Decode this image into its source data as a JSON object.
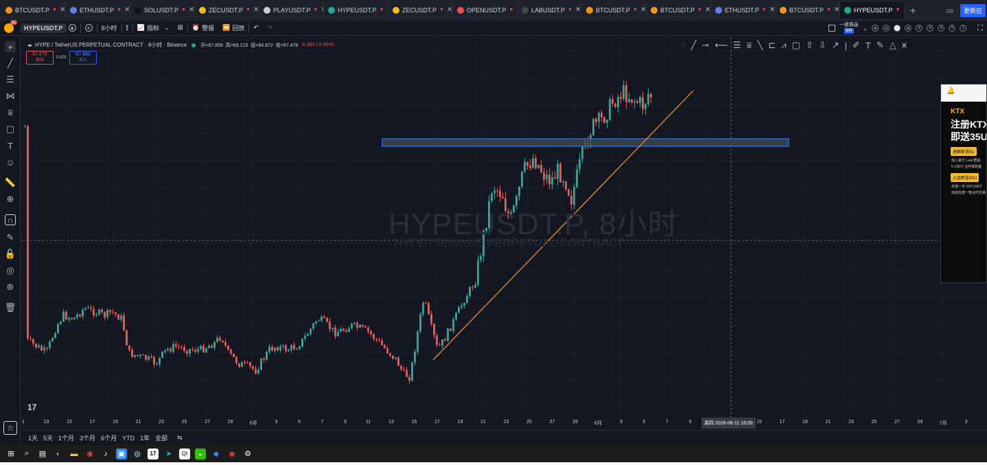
{
  "tabs": [
    {
      "label": "BTCUSDT.P",
      "color": "#f7931a"
    },
    {
      "label": "ETHUSDT.P",
      "color": "#627eea"
    },
    {
      "label": "SOLUSDT.P",
      "color": "#111111"
    },
    {
      "label": "ZECUSDT.P",
      "color": "#f4b728"
    },
    {
      "label": "PLAYUSDT.P",
      "color": "#cccccc"
    },
    {
      "label": "HYPEUSDT.P",
      "color": "#26a69a"
    },
    {
      "label": "ZECUSDT.P",
      "color": "#f4b728"
    },
    {
      "label": "OPENUSDT.P",
      "color": "#ef5350"
    },
    {
      "label": "LABUSDT.P",
      "color": "#444444"
    },
    {
      "label": "BTCUSDT.P",
      "color": "#f7931a"
    },
    {
      "label": "BTCUSDT.P",
      "color": "#f7931a"
    },
    {
      "label": "ETHUSDT.P",
      "color": "#627eea"
    },
    {
      "label": "BTCUSDT.P",
      "color": "#f7931a"
    },
    {
      "label": "HYPEUSDT.P",
      "color": "#26a69a",
      "active": true
    }
  ],
  "update_button": "更新应",
  "toolbar": {
    "symbol": "HYPEUSDT.P",
    "badge": "11",
    "interval": "8小时",
    "indicators": "指标",
    "alert": "警报",
    "replay": "回放",
    "layout": "一键换画",
    "layout_sub": "保存"
  },
  "legend": {
    "symbol": "HYPE / TetherUS PERPETUAL CONTRACT · 8小时 · Binance",
    "open": "开=67.859",
    "high": "高=69.123",
    "low": "低=64.872",
    "close": "收=67.476",
    "change": "-0.383 (-0.56%)"
  },
  "order": {
    "sell_price": "67.479",
    "sell_label": "卖出",
    "spread": "0.001",
    "buy_price": "67.480",
    "buy_label": "买入"
  },
  "watermark": {
    "title": "HYPEUSDT.P, 8小时",
    "subtitle": "HYPE / TetherUS PERPETUAL CONTRACT"
  },
  "ad": {
    "brand": "KTX",
    "line1": "注册KTX",
    "line2": "即送35U",
    "pill1": "进群即送5U",
    "small1": "加入官方 Lark 群后",
    "small2": "5 USDT 合约体验金",
    "pill2": "入金即送30U",
    "small3": "充值一次 100 USDT",
    "small4": "完成任意一笔合约交易"
  },
  "time_axis": [
    "1",
    "13",
    "15",
    "17",
    "19",
    "21",
    "23",
    "25",
    "27",
    "29",
    "5月",
    "3",
    "5",
    "7",
    "9",
    "11",
    "13",
    "15",
    "17",
    "19",
    "21",
    "23",
    "25",
    "27",
    "29",
    "6月",
    "3",
    "5",
    "7",
    "9",
    "11",
    "13",
    "15",
    "17",
    "19",
    "21",
    "23",
    "25",
    "27",
    "29",
    "7月",
    "3"
  ],
  "crosshair_time": "周四 2026-06-11   16:00",
  "ranges": [
    "1天",
    "5天",
    "1个月",
    "3个月",
    "6个月",
    "YTD",
    "1年",
    "全部"
  ],
  "colors": {
    "up": "#26a69a",
    "down": "#ef5350",
    "trend": "#d9822b",
    "zone": "#2962ff"
  }
}
